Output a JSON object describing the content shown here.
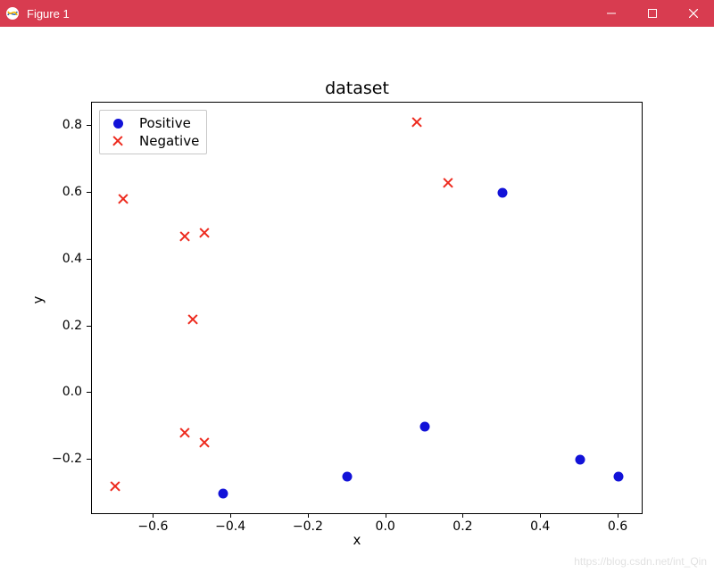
{
  "window": {
    "title": "Figure 1"
  },
  "chart_data": {
    "type": "scatter",
    "title": "dataset",
    "xlabel": "x",
    "ylabel": "y",
    "xlim": [
      -0.76,
      0.66
    ],
    "ylim": [
      -0.36,
      0.87
    ],
    "xticks": [
      -0.6,
      -0.4,
      -0.2,
      0.0,
      0.2,
      0.4,
      0.6
    ],
    "yticks": [
      -0.2,
      0.0,
      0.2,
      0.4,
      0.6,
      0.8
    ],
    "series": [
      {
        "name": "Positive",
        "marker": "dot",
        "color": "#1212d8",
        "points": [
          {
            "x": 0.3,
            "y": 0.6
          },
          {
            "x": 0.1,
            "y": -0.1
          },
          {
            "x": -0.1,
            "y": -0.25
          },
          {
            "x": 0.5,
            "y": -0.2
          },
          {
            "x": 0.6,
            "y": -0.25
          },
          {
            "x": -0.42,
            "y": -0.3
          }
        ]
      },
      {
        "name": "Negative",
        "marker": "x",
        "color": "#ed2a1e",
        "points": [
          {
            "x": -0.68,
            "y": 0.58
          },
          {
            "x": -0.52,
            "y": 0.47
          },
          {
            "x": -0.47,
            "y": 0.48
          },
          {
            "x": -0.5,
            "y": 0.22
          },
          {
            "x": -0.52,
            "y": -0.12
          },
          {
            "x": -0.47,
            "y": -0.15
          },
          {
            "x": -0.7,
            "y": -0.28
          },
          {
            "x": 0.08,
            "y": 0.81
          },
          {
            "x": 0.16,
            "y": 0.63
          }
        ]
      }
    ],
    "legend_position": "upper left"
  },
  "watermark": "https://blog.csdn.net/int_Qin"
}
